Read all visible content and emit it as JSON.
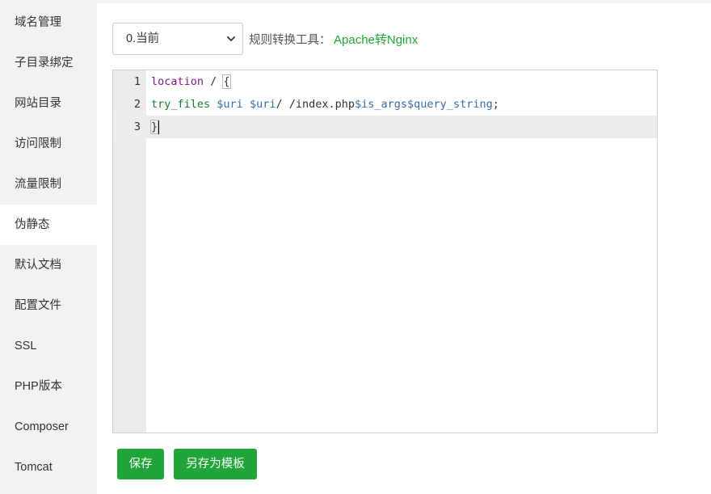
{
  "sidebar": {
    "items": [
      {
        "label": "域名管理"
      },
      {
        "label": "子目录绑定"
      },
      {
        "label": "网站目录"
      },
      {
        "label": "访问限制"
      },
      {
        "label": "流量限制"
      },
      {
        "label": "伪静态",
        "active": true
      },
      {
        "label": "默认文档"
      },
      {
        "label": "配置文件"
      },
      {
        "label": "SSL"
      },
      {
        "label": "PHP版本"
      },
      {
        "label": "Composer"
      },
      {
        "label": "Tomcat"
      }
    ]
  },
  "template_select": {
    "value": "0.当前",
    "icon": "chevron-down-icon"
  },
  "converter": {
    "label": "规则转换工具：",
    "link_text": "Apache转Nginx",
    "link_color": "#20a53a"
  },
  "editor": {
    "lines": [
      {
        "num": "1",
        "parts": [
          {
            "t": "location",
            "c": "kw"
          },
          {
            "t": " / ",
            "c": ""
          },
          {
            "t": "{",
            "c": "brk"
          }
        ]
      },
      {
        "num": "2",
        "parts": [
          {
            "t": "try_files",
            "c": "fn"
          },
          {
            "t": " ",
            "c": ""
          },
          {
            "t": "$uri",
            "c": "var"
          },
          {
            "t": " ",
            "c": ""
          },
          {
            "t": "$uri",
            "c": "var"
          },
          {
            "t": "/ /index.php",
            "c": ""
          },
          {
            "t": "$is_args",
            "c": "var"
          },
          {
            "t": "$query_string",
            "c": "var"
          },
          {
            "t": ";",
            "c": ""
          }
        ]
      },
      {
        "num": "3",
        "parts": [
          {
            "t": "}",
            "c": "brk"
          }
        ],
        "cursor": true
      }
    ]
  },
  "buttons": {
    "save_label": "保存",
    "save_as_template_label": "另存为模板",
    "color": "#20a53a"
  }
}
